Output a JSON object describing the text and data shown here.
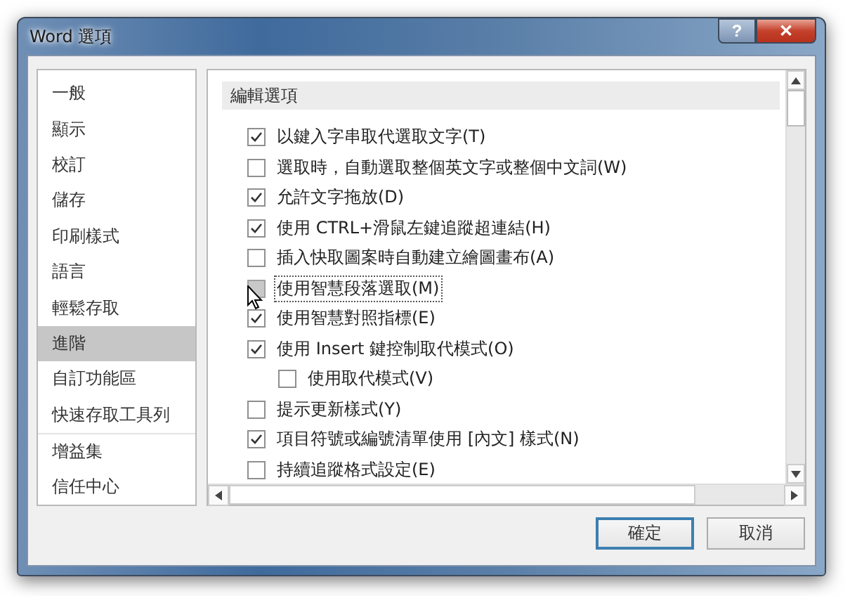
{
  "window": {
    "title": "Word 選項",
    "controls": [
      {
        "kind": "help",
        "glyph": "?"
      },
      {
        "kind": "close",
        "glyph": "✕"
      }
    ]
  },
  "sidebar": {
    "groups": [
      {
        "items": [
          {
            "label": "一般",
            "selected": false
          },
          {
            "label": "顯示",
            "selected": false
          },
          {
            "label": "校訂",
            "selected": false
          },
          {
            "label": "儲存",
            "selected": false
          },
          {
            "label": "印刷樣式",
            "selected": false
          },
          {
            "label": "語言",
            "selected": false
          },
          {
            "label": "輕鬆存取",
            "selected": false
          },
          {
            "label": "進階",
            "selected": true
          },
          {
            "label": "自訂功能區",
            "selected": false
          },
          {
            "label": "快速存取工具列",
            "selected": false
          }
        ]
      },
      {
        "items": [
          {
            "label": "增益集",
            "selected": false
          },
          {
            "label": "信任中心",
            "selected": false
          }
        ]
      }
    ]
  },
  "section": {
    "title": "編輯選項",
    "options": [
      {
        "label": "以鍵入字串取代選取文字(T)",
        "checked": true,
        "focused": false
      },
      {
        "label": "選取時，自動選取整個英文字或整個中文詞(W)",
        "checked": false,
        "focused": false
      },
      {
        "label": "允許文字拖放(D)",
        "checked": true,
        "focused": false
      },
      {
        "label": "使用 CTRL+滑鼠左鍵追蹤超連結(H)",
        "checked": true,
        "focused": false
      },
      {
        "label": "插入快取圖案時自動建立繪圖畫布(A)",
        "checked": false,
        "focused": false
      },
      {
        "label": "使用智慧段落選取(M)",
        "checked": false,
        "focused": true
      },
      {
        "label": "使用智慧對照指標(E)",
        "checked": true,
        "focused": false
      },
      {
        "label": "使用 Insert 鍵控制取代模式(O)",
        "checked": true,
        "focused": false,
        "children": [
          {
            "label": "使用取代模式(V)",
            "checked": false,
            "focused": false
          }
        ]
      },
      {
        "label": "提示更新樣式(Y)",
        "checked": false,
        "focused": false
      },
      {
        "label": "項目符號或編號清單使用 [內文] 樣式(N)",
        "checked": true,
        "focused": false
      },
      {
        "label": "持續追蹤格式設定(E)",
        "checked": false,
        "focused": false
      }
    ]
  },
  "buttons": [
    {
      "label": "確定",
      "default": true
    },
    {
      "label": "取消",
      "default": false
    }
  ]
}
